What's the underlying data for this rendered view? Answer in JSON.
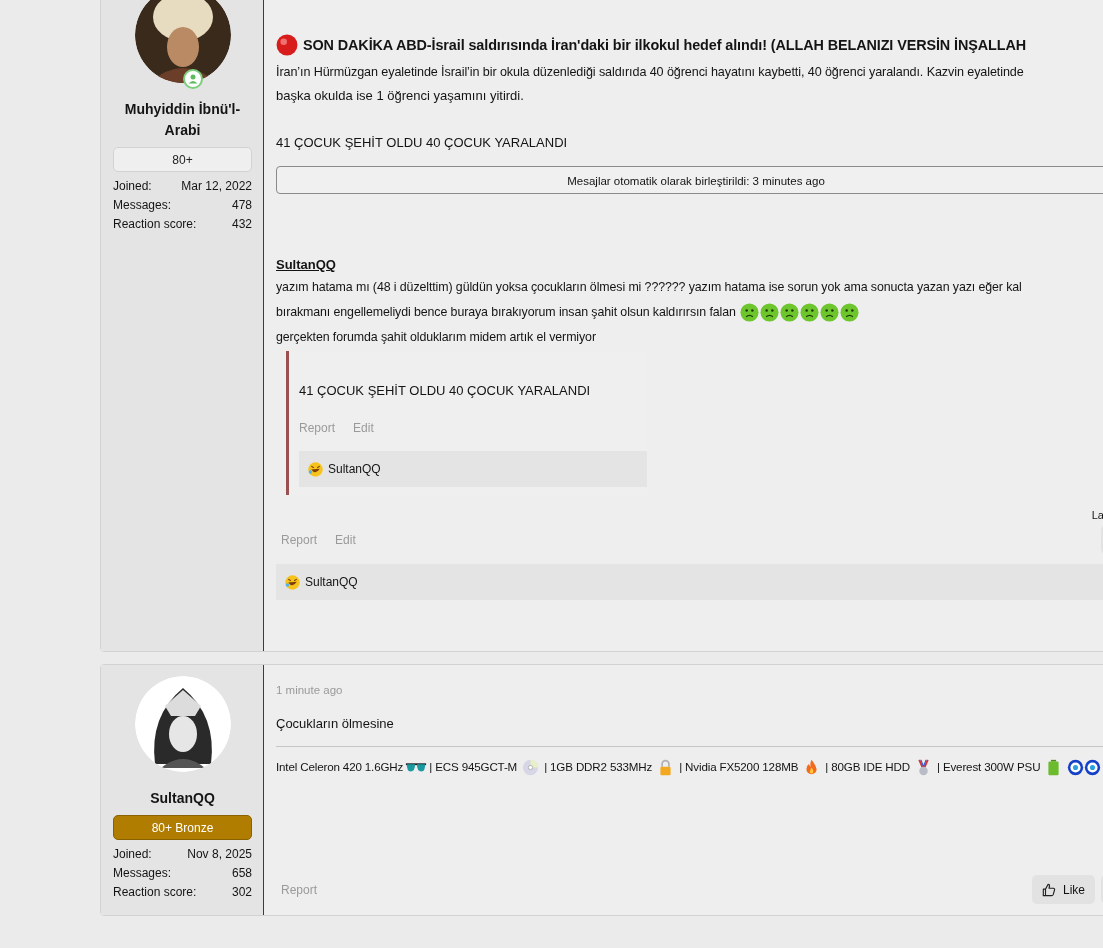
{
  "posts": [
    {
      "author": {
        "name": "Muhyiddin İbnü'l-Arabi",
        "online": true,
        "banner": {
          "kind": "plain",
          "text": "80+"
        },
        "stats": [
          {
            "label": "Joined:",
            "value": "Mar 12, 2022"
          },
          {
            "label": "Messages:",
            "value": "478"
          },
          {
            "label": "Reaction score:",
            "value": "432"
          }
        ]
      },
      "title": "SON DAKİKA ABD-İsrail saldırısında İran'daki bir ilkokul hedef alındı! (ALLAH BELANIZI VERSİN İNŞALLAH",
      "paragraph": [
        "İran’ın Hürmüzgan eyaletinde İsrail’in bir okula düzenlediği saldırıda 40 öğrenci hayatını kaybetti, 40 öğrenci yaralandı. Kazvin eyaletinde",
        "başka okulda ise 1 öğrenci yaşamını yitirdi."
      ],
      "headline": "41 ÇOCUK ŞEHİT OLDU 40 ÇOCUK YARALANDI",
      "merge_notice": "Mesajlar otomatik olarak birleştirildi: 3 minutes ago",
      "reply_author": "SultanQQ",
      "reply_lines": [
        "yazım hatama mı (48 i düzelttim) güldün yoksa çocukların ölmesi mi ?????? yazım hatama ise sorun yok ama sonucta yazan yazı eğer kal",
        "bırakmanı engellemeliydi bence buraya bırakıyorum insan şahit olsun kaldırırsın falan",
        "gerçekten forumda şahit olduklarım midem artık el vermiyor"
      ],
      "quote": {
        "text": "41 ÇOCUK ŞEHİT OLDU 40 ÇOCUK YARALANDI",
        "actions": [
          "Report",
          "Edit"
        ],
        "reaction_users": "SultanQQ"
      },
      "side_note": "La",
      "actions": [
        "Report",
        "Edit"
      ],
      "reaction_users": "SultanQQ"
    },
    {
      "author": {
        "name": "SultanQQ",
        "banner": {
          "kind": "bronze",
          "text": "80+ Bronze"
        },
        "stats": [
          {
            "label": "Joined:",
            "value": "Nov 8, 2025"
          },
          {
            "label": "Messages:",
            "value": "658"
          },
          {
            "label": "Reaction score:",
            "value": "302"
          }
        ]
      },
      "time": "1 minute ago",
      "text": "Çocukların ölmesine",
      "signature": [
        "Intel Celeron 420 1.6GHz",
        "| ECS 945GCT-M",
        "| 1GB DDR2 533MHz",
        "| Nvidia FX5200 128MB",
        "| 80GB IDE HDD",
        "| Everest 300W PSU"
      ],
      "actions": [
        "Report"
      ],
      "like": "Like"
    }
  ]
}
